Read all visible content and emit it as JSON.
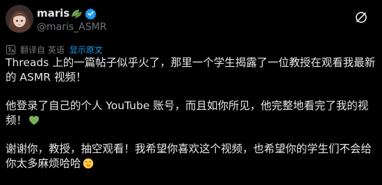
{
  "post": {
    "author_name": "maris",
    "handle": "@maris_ASMR",
    "translation_label": "翻译自 英语",
    "show_original_label": "显示原文",
    "paragraph1": "Threads 上的一篇帖子似乎火了，那里一个学生揭露了一位教授在观看我最新的 ASMR 视频！",
    "paragraph2": "他登录了自己的个人 YouTube 账号，而且如你所见，他完整地看完了我的视频！",
    "paragraph3": "谢谢你，教授，抽空观看！我希望你喜欢这个视频，也希望你的学生们不会给你太多麻烦哈哈"
  },
  "icons": {
    "avatar": "avatar-image",
    "name_emoji": "leaves-icon",
    "verified": "verified-badge-icon",
    "top_action": "slash-circle-icon",
    "translate": "translate-icon",
    "heart": "green-heart-emoji",
    "smile": "hand-over-mouth-emoji"
  },
  "colors": {
    "background": "#000000",
    "text": "#e7e9ea",
    "secondary": "#71767b",
    "link": "#1d9bf0",
    "verified": "#1d9bf0",
    "heart": "#78b159"
  }
}
